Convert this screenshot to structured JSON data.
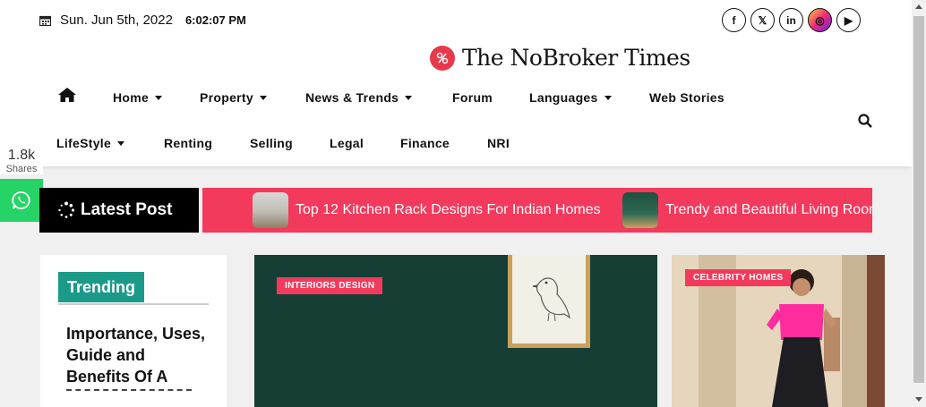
{
  "topbar": {
    "date": "Sun. Jun 5th, 2022",
    "time": "6:02:07 PM"
  },
  "socials": [
    {
      "label": "f",
      "icon": "facebook-icon"
    },
    {
      "label": "𝕏",
      "icon": "twitter-icon"
    },
    {
      "label": "in",
      "icon": "linkedin-icon"
    },
    {
      "label": "◎",
      "icon": "instagram-icon"
    },
    {
      "label": "▶",
      "icon": "youtube-icon"
    }
  ],
  "logo": {
    "text": "The NoBroker Times"
  },
  "nav": {
    "row1": [
      "Home",
      "Property",
      "News & Trends",
      "Forum",
      "Languages",
      "Web Stories"
    ],
    "row2": [
      "LifeStyle",
      "Renting",
      "Selling",
      "Legal",
      "Finance",
      "NRI"
    ]
  },
  "shares": {
    "count": "1.8k",
    "label": "Shares"
  },
  "latest_post": {
    "label": "Latest Post"
  },
  "ticker": [
    "Top 12 Kitchen Rack Designs For Indian Homes",
    "Trendy and Beautiful Living Room"
  ],
  "trending": {
    "label": "Trending",
    "title": "Importance, Uses, Guide and Benefits Of A"
  },
  "featured": {
    "badge": "INTERIORS DESIGN"
  },
  "side_card": {
    "badge": "CELEBRITY HOMES"
  },
  "colors": {
    "accent": "#f33a5d",
    "trending": "#1b9a8a",
    "whatsapp": "#25d366"
  }
}
